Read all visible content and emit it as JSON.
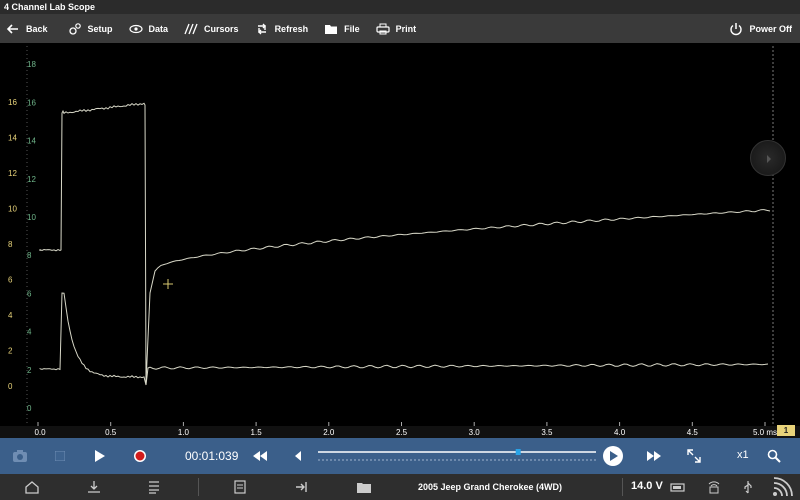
{
  "app": {
    "title": "4 Channel Lab Scope"
  },
  "toolbar": {
    "back": "Back",
    "setup": "Setup",
    "data": "Data",
    "cursors": "Cursors",
    "refresh": "Refresh",
    "file": "File",
    "print": "Print",
    "power_off": "Power Off"
  },
  "scope": {
    "y_ticks_ch1": [
      "0",
      "2",
      "4",
      "6",
      "8",
      "10",
      "12",
      "14",
      "16"
    ],
    "y_ticks_ch2": [
      "0",
      "2",
      "4",
      "6",
      "8",
      "10",
      "12",
      "14",
      "16",
      "18"
    ],
    "x_ticks": [
      "0.0",
      "0.5",
      "1.0",
      "1.5",
      "2.0",
      "2.5",
      "3.0",
      "3.5",
      "4.0",
      "4.5",
      "5.0 ms"
    ],
    "channel_badges": [
      "1",
      "2"
    ],
    "colors": {
      "ch1": "#e8d37a",
      "ch2": "#6fb58a",
      "trace": "#d8d8c8"
    }
  },
  "playbar": {
    "time": "00:01:039",
    "zoom": "x1",
    "progress": 0.72
  },
  "status": {
    "vehicle": "2005 Jeep Grand Cherokee (4WD)",
    "voltage": "14.0 V"
  }
}
